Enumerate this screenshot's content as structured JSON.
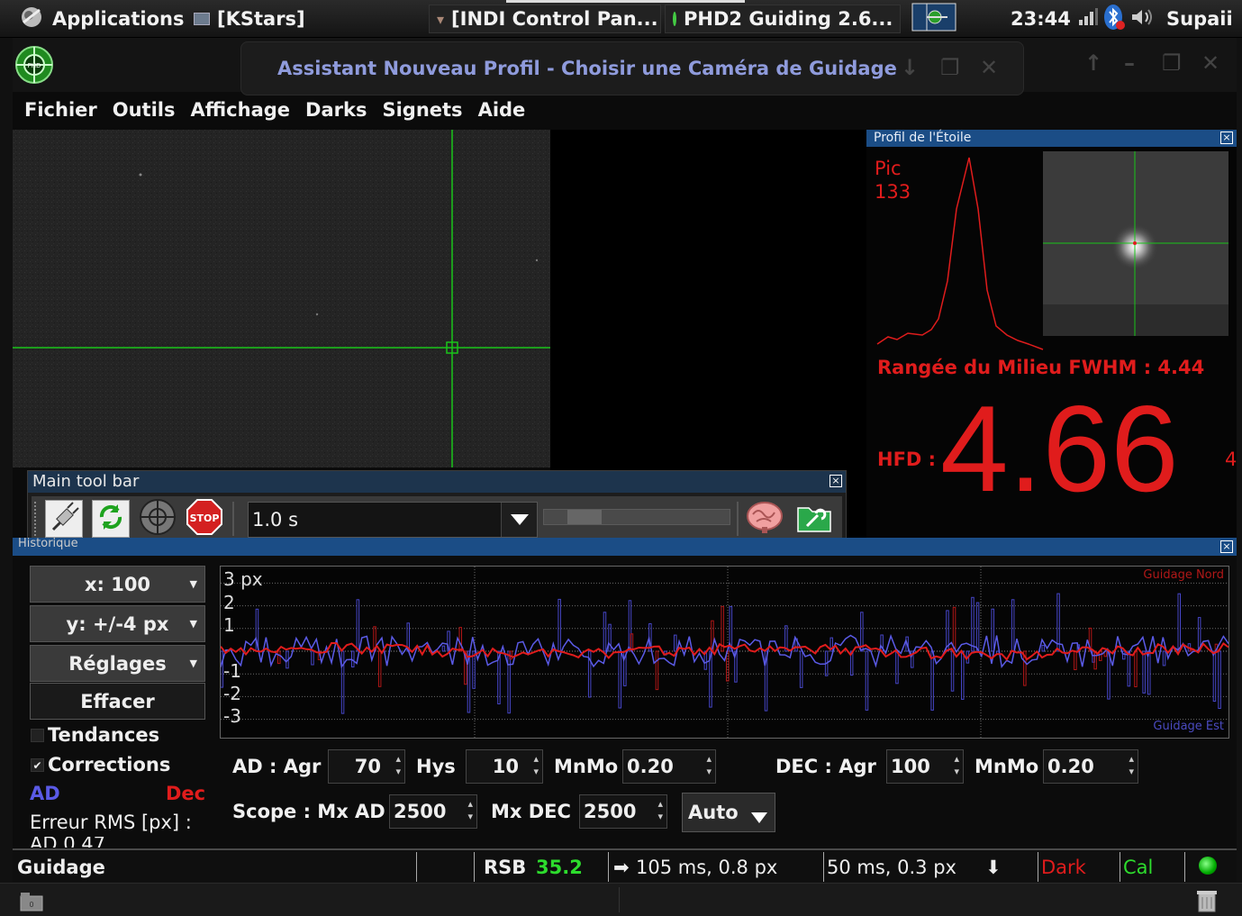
{
  "top_panel": {
    "applications": "Applications",
    "task_kstars": "[KStars]",
    "task_indi": "[INDI Control Pan...",
    "task_phd2": "PHD2 Guiding 2.6...",
    "clock": "23:44",
    "user": "Supaii"
  },
  "window": {
    "dialog_title": "Assistant Nouveau Profil - Choisir une Caméra de Guidage",
    "menu": [
      {
        "label": "Fichier"
      },
      {
        "label": "Outils"
      },
      {
        "label": "Affichage"
      },
      {
        "label": "Darks"
      },
      {
        "label": "Signets"
      },
      {
        "label": "Aide"
      }
    ]
  },
  "star_profile": {
    "title": "Profil de l'Étoile",
    "peak_label": "Pic",
    "peak_value": "133",
    "fwhm_text": "Rangée du Milieu FWHM : 4.44",
    "hfd_label": "HFD :",
    "hfd_value": "4.66",
    "hfd_cut": "4"
  },
  "main_toolbar": {
    "title": "Main tool bar",
    "exposure": "1.0 s",
    "stop_label": "STOP",
    "icons": [
      "usb-plug-icon",
      "loop-icon",
      "guide-target-icon",
      "stop-icon",
      "brain-icon",
      "profile-wizard-icon"
    ]
  },
  "history": {
    "title": "Historique",
    "x_scale": "x: 100",
    "y_scale": "y: +/-4 px",
    "settings": "Réglages",
    "clear": "Effacer",
    "trends": "Tendances",
    "corrections": "Corrections",
    "ra_label": "AD",
    "dec_label": "Dec",
    "rms_label": "Erreur RMS [px] :",
    "rms_partial": "AD   0.47",
    "graph_labels": {
      "y3": "3 px",
      "y2": "2",
      "y1": "1",
      "ym1": "-1",
      "ym2": "-2",
      "ym3": "-3",
      "north": "Guidage Nord",
      "east": "Guidage Est"
    },
    "controls": {
      "ra_agr_label": "AD : Agr",
      "ra_agr": "70",
      "hys_label": "Hys",
      "hys": "10",
      "minmo_label": "MnMo",
      "ra_minmo": "0.20",
      "dec_agr_label": "DEC : Agr",
      "dec_agr": "100",
      "dec_minmo": "0.20",
      "scope_label": "Scope : Mx AD",
      "max_ra": "2500",
      "max_dec_label": "Mx DEC",
      "max_dec": "2500",
      "dec_mode": "Auto"
    },
    "colors": {
      "ra": "#5a5ae6",
      "dec": "#e01c1c"
    }
  },
  "status_bar": {
    "state": "Guidage",
    "snr_label": "RSB",
    "snr_value": "35.2",
    "ra_pulse": "105 ms, 0.8 px",
    "dec_pulse": "50 ms, 0.3 px",
    "dark": "Dark",
    "cal": "Cal"
  }
}
